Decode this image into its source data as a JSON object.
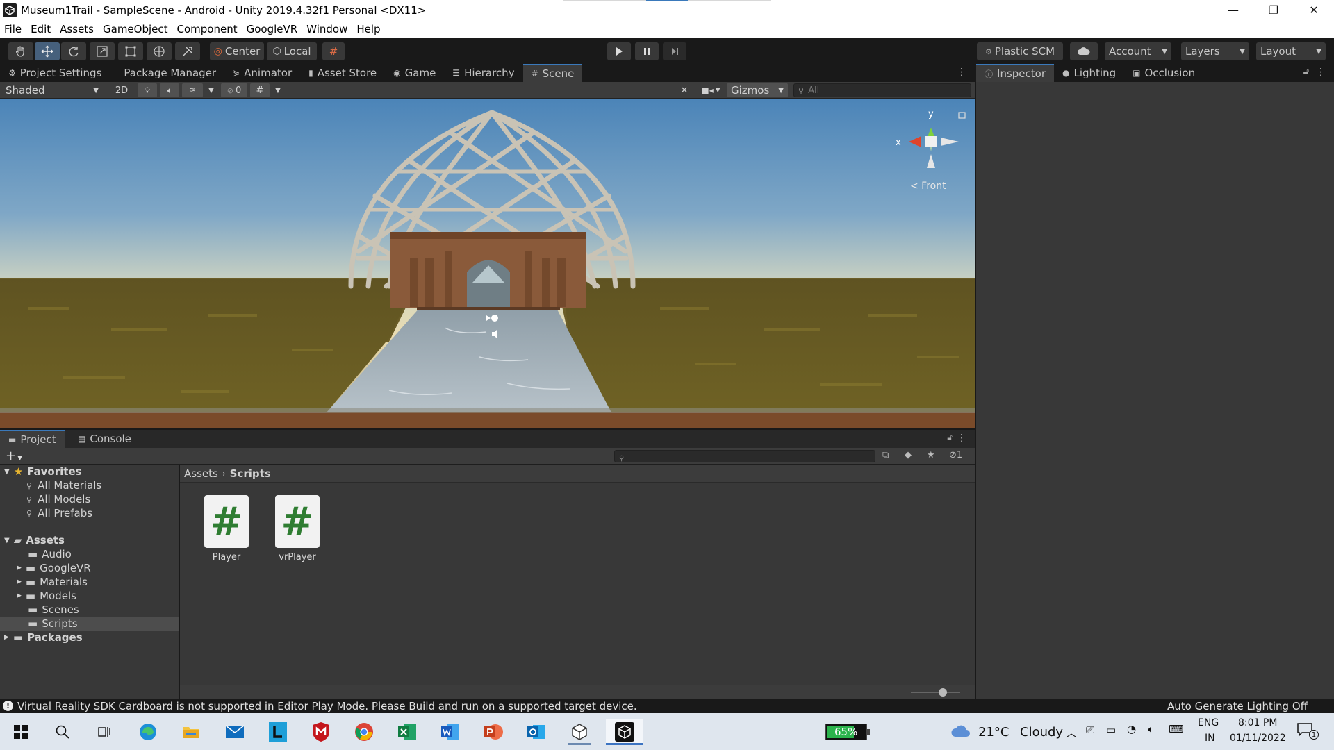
{
  "window": {
    "title": "Museum1Trail - SampleScene - Android - Unity 2019.4.32f1 Personal <DX11>",
    "minimize": "—",
    "maximize": "❐",
    "close": "✕"
  },
  "menu": [
    "File",
    "Edit",
    "Assets",
    "GameObject",
    "Component",
    "GoogleVR",
    "Window",
    "Help"
  ],
  "toolbar": {
    "pivot_label": "Center",
    "space_label": "Local",
    "plastic_label": "Plastic SCM",
    "account_label": "Account",
    "layers_label": "Layers",
    "layout_label": "Layout"
  },
  "left_tabs": [
    {
      "label": "Project Settings",
      "icon": "gear-icon"
    },
    {
      "label": "Package Manager",
      "icon": "package-icon"
    },
    {
      "label": "Animator",
      "icon": "animator-icon"
    },
    {
      "label": "Asset Store",
      "icon": "store-icon"
    },
    {
      "label": "Game",
      "icon": "gamepad-icon"
    },
    {
      "label": "Hierarchy",
      "icon": "list-icon"
    },
    {
      "label": "Scene",
      "icon": "grid-icon"
    }
  ],
  "right_tabs": [
    {
      "label": "Inspector",
      "icon": "info-icon"
    },
    {
      "label": "Lighting",
      "icon": "bulb-icon"
    },
    {
      "label": "Occlusion",
      "icon": "occlusion-icon"
    }
  ],
  "scene_toolbar": {
    "draw_mode": "Shaded",
    "mode_2d": "2D",
    "hidden_count": "0",
    "gizmos_label": "Gizmos",
    "search_placeholder": "All"
  },
  "scene_gizmo": {
    "y_label": "y",
    "x_label": "x",
    "view_label": "Front"
  },
  "project_tabs": [
    {
      "label": "Project",
      "icon": "folder-icon"
    },
    {
      "label": "Console",
      "icon": "console-icon"
    }
  ],
  "project": {
    "add_label": "+",
    "hidden_packages_count": "1",
    "breadcrumb": [
      "Assets",
      "Scripts"
    ],
    "favorites_label": "Favorites",
    "favorites": [
      "All Materials",
      "All Models",
      "All Prefabs"
    ],
    "assets_label": "Assets",
    "folders": [
      {
        "name": "Audio",
        "expandable": false
      },
      {
        "name": "GoogleVR",
        "expandable": true
      },
      {
        "name": "Materials",
        "expandable": true
      },
      {
        "name": "Models",
        "expandable": true
      },
      {
        "name": "Scenes",
        "expandable": false
      },
      {
        "name": "Scripts",
        "expandable": false,
        "selected": true
      }
    ],
    "packages_label": "Packages",
    "files": [
      {
        "name": "Player",
        "glyph": "#"
      },
      {
        "name": "vrPlayer",
        "glyph": "#"
      }
    ]
  },
  "status": {
    "message": "Virtual Reality SDK Cardboard is not supported in Editor Play Mode. Please Build and run on a supported target device.",
    "lighting": "Auto Generate Lighting Off"
  },
  "taskbar": {
    "battery": "65%",
    "weather_temp": "21°C",
    "weather_desc": "Cloudy",
    "lang_top": "ENG",
    "lang_bottom": "IN",
    "time": "8:01 PM",
    "date": "01/11/2022",
    "notif_count": "1"
  },
  "colors": {
    "editor_dark": "#191919",
    "panel": "#383838",
    "selected_tab_accent": "#3a79bb",
    "script_icon_green": "#2f7d32",
    "sky_top": "#4b84b8",
    "horizon": "#e8d8a8",
    "grass": "#6b5a20"
  }
}
